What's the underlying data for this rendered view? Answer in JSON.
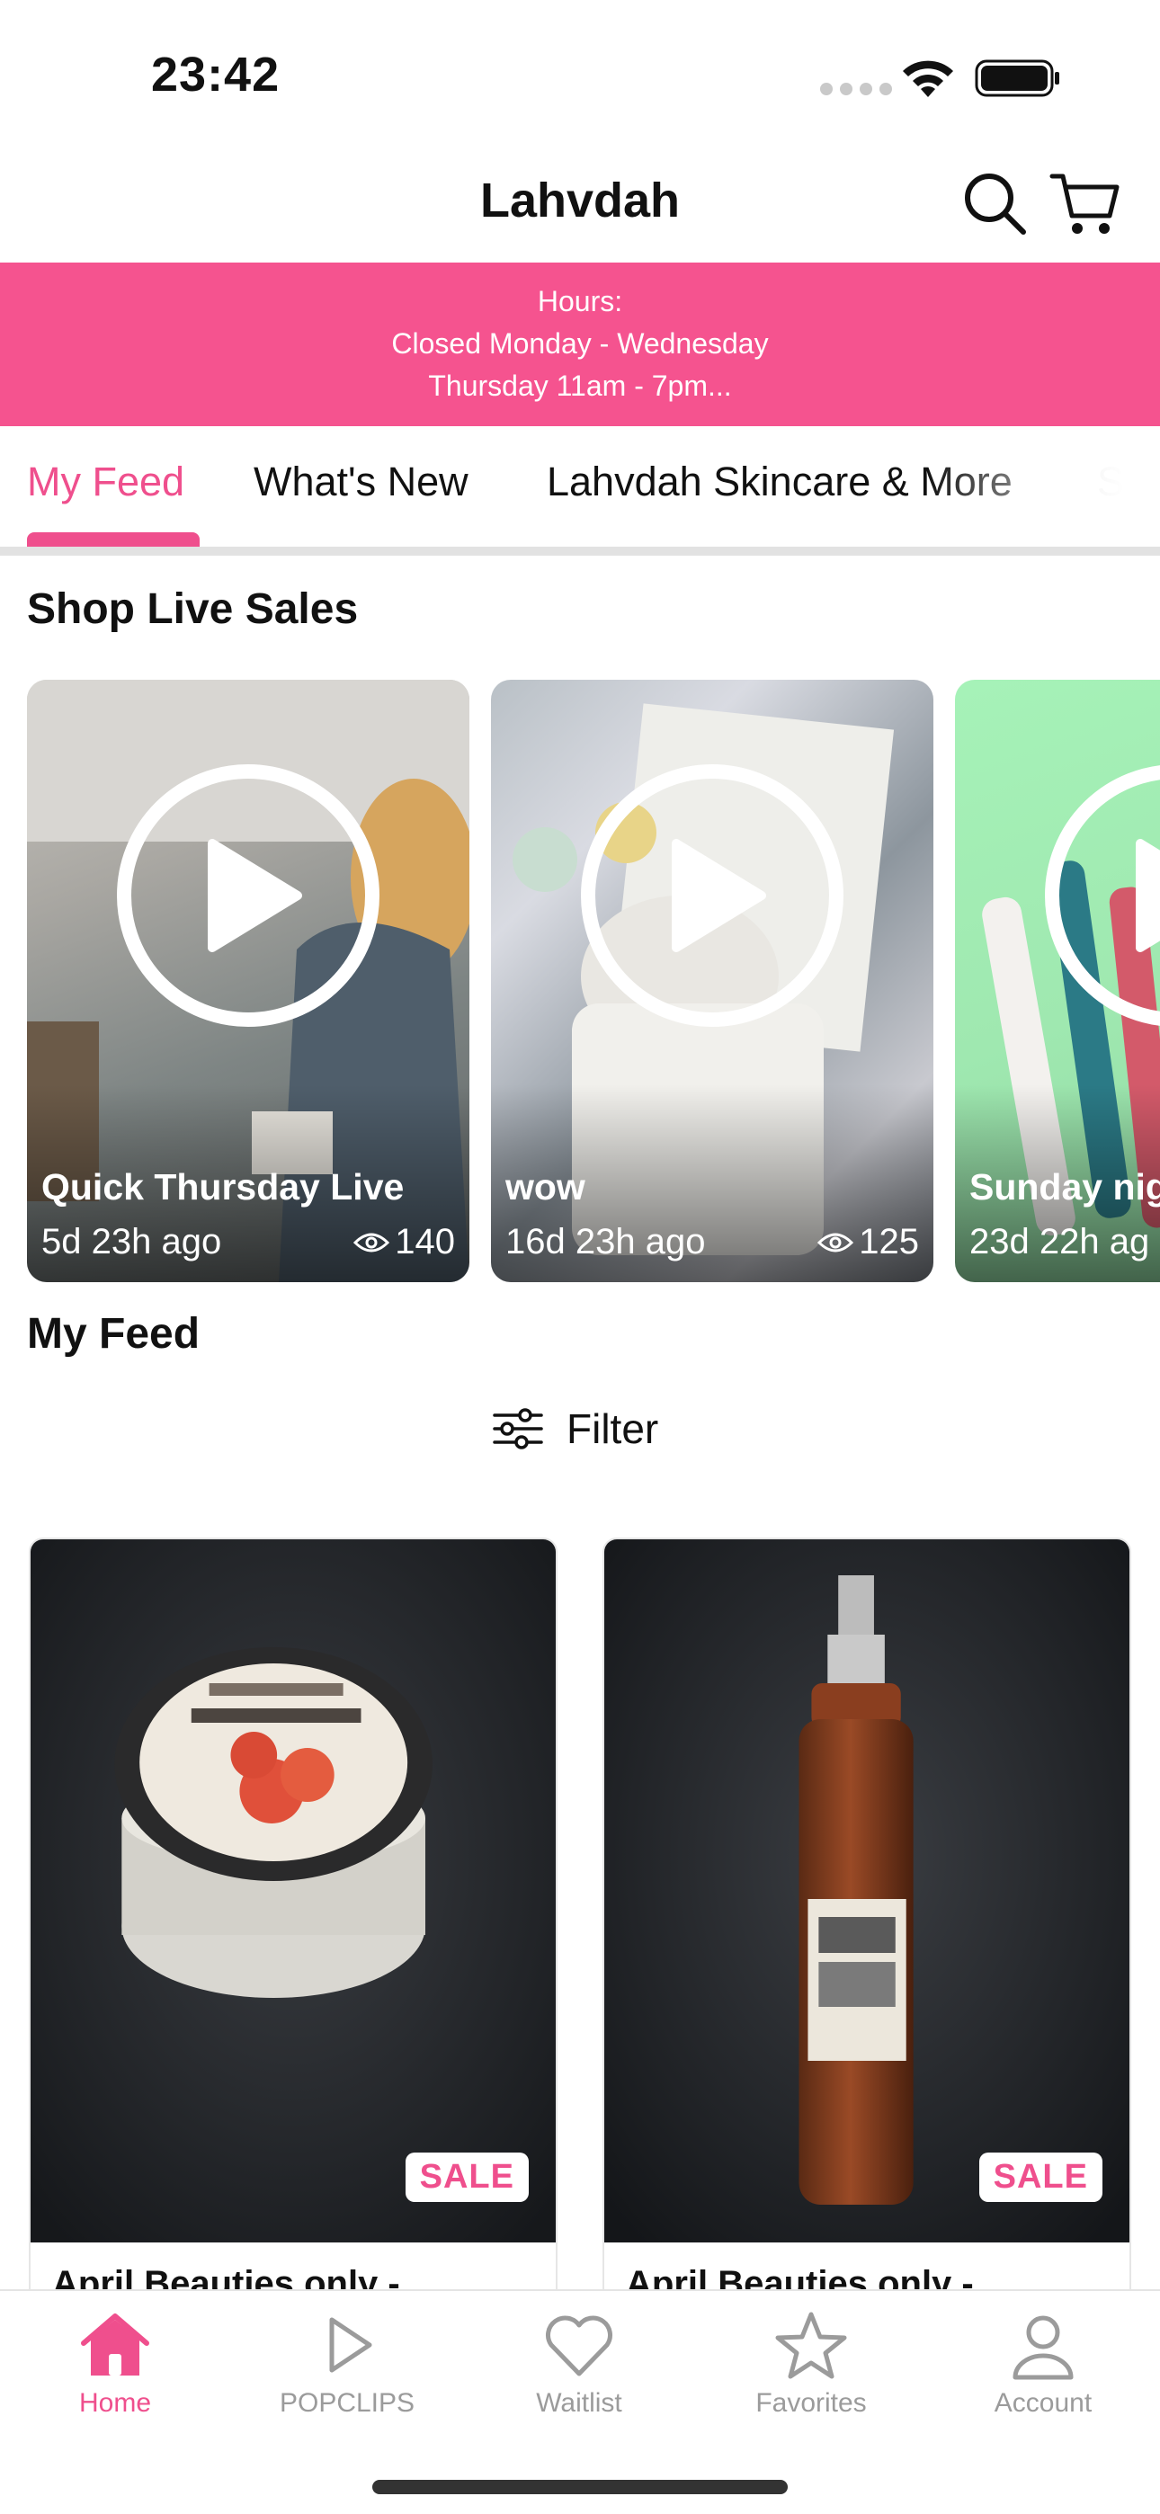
{
  "status_bar": {
    "time": "23:42"
  },
  "header": {
    "title": "Lahvdah"
  },
  "banner": {
    "line1": "Hours:",
    "line2": "Closed Monday - Wednesday",
    "line3": "Thursday 11am - 7pm..."
  },
  "tabs": [
    {
      "label": "My Feed",
      "active": true
    },
    {
      "label": "What's New"
    },
    {
      "label": "Lahvdah Skincare & More"
    },
    {
      "label": "Sp"
    }
  ],
  "live_section": {
    "title": "Shop Live Sales",
    "cards": [
      {
        "title": "Quick Thursday Live",
        "ago": "5d 23h ago",
        "views": "140"
      },
      {
        "title": "wow",
        "ago": "16d 23h ago",
        "views": "125"
      },
      {
        "title": "Sunday nig",
        "ago": "23d 22h ag",
        "views": ""
      }
    ]
  },
  "feed": {
    "title": "My Feed",
    "filter_label": "Filter",
    "products": [
      {
        "name": "April Beauties only -",
        "badge": "SALE"
      },
      {
        "name": "April Beauties only -",
        "badge": "SALE"
      }
    ]
  },
  "bottom_nav": [
    {
      "label": "Home",
      "icon": "home-icon",
      "active": true
    },
    {
      "label": "POPCLIPS",
      "icon": "play-outline-icon"
    },
    {
      "label": "Waitlist",
      "icon": "heart-icon"
    },
    {
      "label": "Favorites",
      "icon": "star-icon"
    },
    {
      "label": "Account",
      "icon": "person-icon"
    }
  ],
  "colors": {
    "brand_pink": "#ef4f8d",
    "banner_pink": "#f5538f",
    "inactive_gray": "#9b9b9b"
  }
}
